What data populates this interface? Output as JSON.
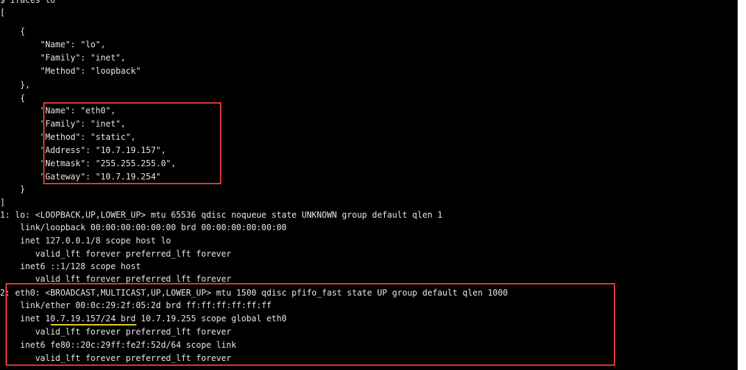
{
  "terminal": {
    "lines": [
      "$ ifaces lo",
      "[",
      "    {",
      "        \"Name\": \"lo\",",
      "        \"Family\": \"inet\",",
      "        \"Method\": \"loopback\"",
      "    },",
      "    {",
      "        \"Name\": \"eth0\",",
      "        \"Family\": \"inet\",",
      "        \"Method\": \"static\",",
      "        \"Address\": \"10.7.19.157\",",
      "        \"Netmask\": \"255.255.255.0\",",
      "        \"Gateway\": \"10.7.19.254\"",
      "    }",
      "]",
      "1: lo: <LOOPBACK,UP,LOWER_UP> mtu 65536 qdisc noqueue state UNKNOWN group default qlen 1",
      "    link/loopback 00:00:00:00:00:00 brd 00:00:00:00:00:00",
      "    inet 127.0.0.1/8 scope host lo",
      "       valid_lft forever preferred_lft forever",
      "    inet6 ::1/128 scope host",
      "       valid_lft forever preferred_lft forever",
      "2: eth0: <BROADCAST,MULTICAST,UP,LOWER_UP> mtu 1500 qdisc pfifo_fast state UP group default qlen 1000",
      "    link/ether 00:0c:29:2f:05:2d brd ff:ff:ff:ff:ff:ff",
      "    inet 10.7.19.157/24 brd 10.7.19.255 scope global eth0",
      "       valid_lft forever preferred_lft forever",
      "    inet6 fe80::20c:29ff:fe2f:52d/64 scope link",
      "       valid_lft forever preferred_lft forever"
    ]
  },
  "colors": {
    "background": "#000000",
    "text": "#e6e6e6",
    "highlight_box": "#e03a3a",
    "underline": "#e6d229"
  }
}
